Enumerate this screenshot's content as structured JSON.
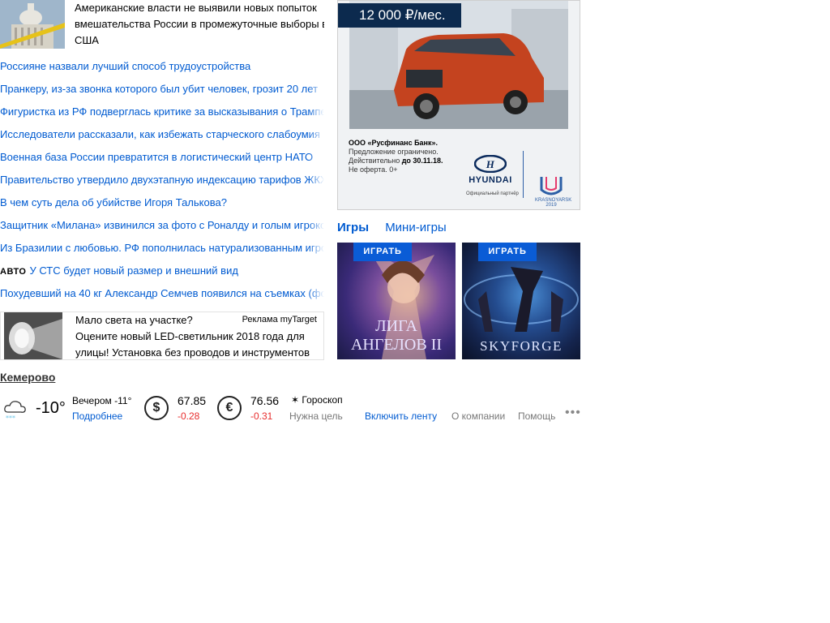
{
  "top_story": {
    "text": "Американские власти не выявили новых попыток вмешательства России в промежуточные выборы в США"
  },
  "news": [
    {
      "tag": "",
      "text": "Россияне назвали лучший способ трудоустройства"
    },
    {
      "tag": "",
      "text": "Пранкеру, из-за звонка которого был убит человек, грозит 20 лет"
    },
    {
      "tag": "",
      "text": "Фигуристка из РФ подверглась критике за высказывания о Трампе"
    },
    {
      "tag": "",
      "text": "Исследователи рассказали, как избежать старческого слабоумия"
    },
    {
      "tag": "",
      "text": "Военная база России превратится в логистический центр НАТО"
    },
    {
      "tag": "",
      "text": "Правительство утвердило двухэтапную индексацию тарифов ЖКХ"
    },
    {
      "tag": "",
      "text": "В чем суть дела об убийстве Игоря Талькова?"
    },
    {
      "tag": "",
      "text": "Защитник «Милана» извинился за фото с Роналду и голым игроком команды"
    },
    {
      "tag": "",
      "text": "Из Бразилии с любовью. РФ пополнилась натурализованным игроком"
    },
    {
      "tag": "АВТО",
      "text": "У СТС будет новый размер и внешний вид"
    },
    {
      "tag": "",
      "text": "Похудевший на 40 кг Александр Семчев появился на съемках (фото)"
    }
  ],
  "ad_target": {
    "title": "Мало света на участке?",
    "label": "Реклама myTarget",
    "description": "Оцените новый LED-светильник 2018 года для улицы! Установка без проводов и инструментов"
  },
  "banner": {
    "price": "12 000 ₽/мес.",
    "bank_name": "ООО «Русфинанс Банк».",
    "bank_line2": "Предложение ограничено.",
    "bank_line3_prefix": "Действительно ",
    "bank_line3_bold": "до 30.11.18.",
    "bank_line4": "Не оферта. 0+",
    "brand": "HYUNDAI",
    "partner": "Официальный партнёр",
    "event": "KRASNOYARSK 2019"
  },
  "games": {
    "tabs": [
      "Игры",
      "Мини-игры"
    ],
    "items": [
      {
        "play": "ИГРАТЬ",
        "title": "ЛИГА АНГЕЛОВ II"
      },
      {
        "play": "ИГРАТЬ",
        "title": "SKYFORGE"
      }
    ]
  },
  "informer": {
    "city": "Кемерово",
    "temp": "-10°",
    "evening": "Вечером -11°",
    "more": "Подробнее",
    "usd": {
      "symbol": "$",
      "value": "67.85",
      "change": "-0.28"
    },
    "eur": {
      "symbol": "€",
      "value": "76.56",
      "change": "-0.31"
    },
    "horoscope": "✶ Гороскоп",
    "goal": "Нужна цель"
  },
  "footer_links": {
    "feed": "Включить ленту",
    "about": "О компании",
    "help": "Помощь",
    "more": "•••"
  },
  "colors": {
    "link": "#005bd1",
    "negative": "#e82e2e",
    "play_button": "#0a5cd6"
  }
}
